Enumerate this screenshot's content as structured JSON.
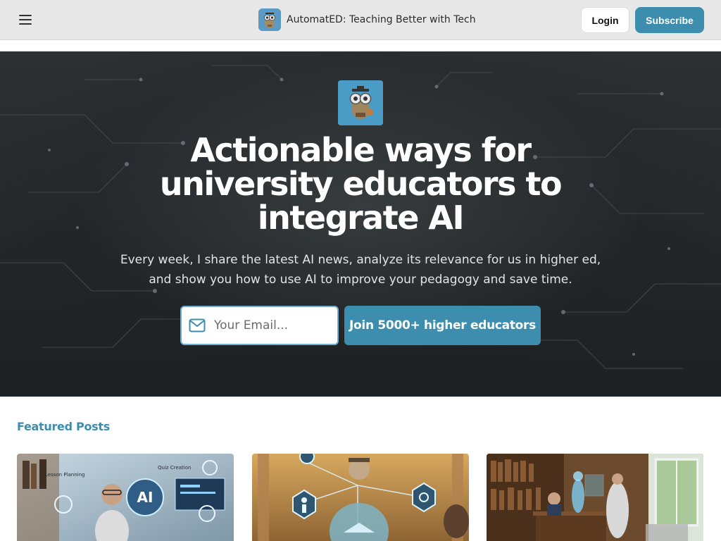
{
  "header": {
    "brand_name": "AutomatED: Teaching Better with Tech",
    "menu_icon": "hamburger-menu-icon",
    "logo_icon": "robot-owl-logo-icon",
    "login_label": "Login",
    "subscribe_label": "Subscribe"
  },
  "hero": {
    "logo_icon": "robot-owl-logo-icon",
    "title": "Actionable ways for university educators to integrate AI",
    "subtitle": "Every week, I share the latest AI news, analyze its relevance for us in higher ed, and show you how to use AI to improve your pedagogy and save time.",
    "email_placeholder": "Your Email...",
    "email_icon": "envelope-icon",
    "join_label": "Join 5000+ higher educators"
  },
  "featured": {
    "heading": "Featured Posts",
    "cards": [
      {
        "image": "educator-ai-dashboard-image",
        "image_labels": [
          "Lesson Planning",
          "Quiz Creation",
          "AI"
        ]
      },
      {
        "image": "scholar-hologram-network-image"
      },
      {
        "image": "library-hologram-desk-image"
      }
    ]
  },
  "colors": {
    "accent": "#3c8dae",
    "header_bg": "#e8e8e8",
    "hero_bg": "#26292b",
    "input_border": "#6cb0d2",
    "heading": "#3c8dae"
  }
}
